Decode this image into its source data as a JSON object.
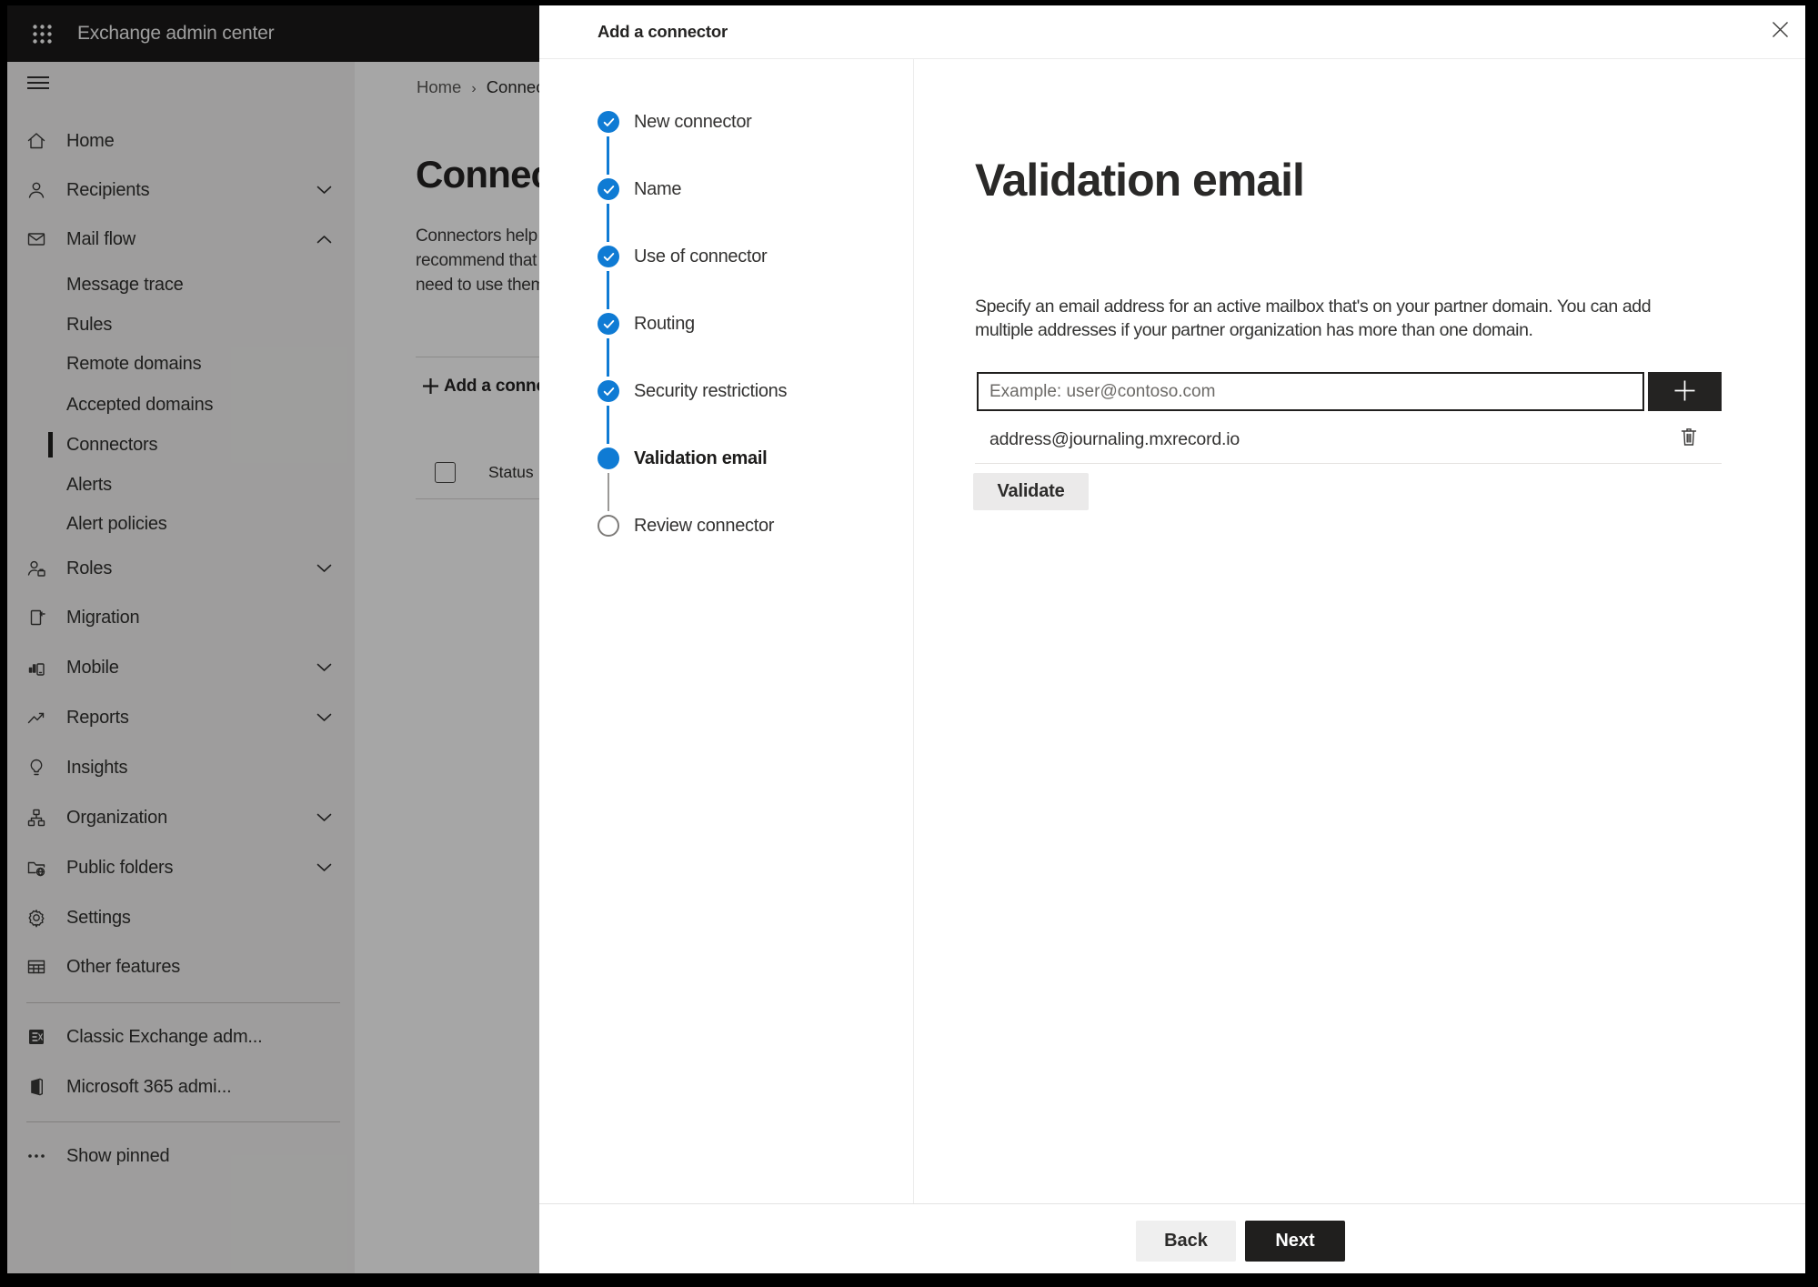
{
  "app": {
    "topbar_title": "Exchange admin center"
  },
  "sidebar": {
    "items": [
      {
        "label": "Home",
        "icon": "home-icon",
        "type": "top"
      },
      {
        "label": "Recipients",
        "icon": "people-icon",
        "type": "top",
        "chevron": "down"
      },
      {
        "label": "Mail flow",
        "icon": "mail-icon",
        "type": "top",
        "chevron": "up",
        "expanded": true
      },
      {
        "label": "Message trace",
        "type": "sub"
      },
      {
        "label": "Rules",
        "type": "sub"
      },
      {
        "label": "Remote domains",
        "type": "sub"
      },
      {
        "label": "Accepted domains",
        "type": "sub"
      },
      {
        "label": "Connectors",
        "type": "sub",
        "selected": true
      },
      {
        "label": "Alerts",
        "type": "sub"
      },
      {
        "label": "Alert policies",
        "type": "sub"
      },
      {
        "label": "Roles",
        "icon": "roles-icon",
        "type": "top",
        "chevron": "down"
      },
      {
        "label": "Migration",
        "icon": "migration-icon",
        "type": "top"
      },
      {
        "label": "Mobile",
        "icon": "mobile-icon",
        "type": "top",
        "chevron": "down"
      },
      {
        "label": "Reports",
        "icon": "reports-icon",
        "type": "top",
        "chevron": "down"
      },
      {
        "label": "Insights",
        "icon": "insights-icon",
        "type": "top"
      },
      {
        "label": "Organization",
        "icon": "organization-icon",
        "type": "top",
        "chevron": "down"
      },
      {
        "label": "Public folders",
        "icon": "public-folders-icon",
        "type": "top",
        "chevron": "down"
      },
      {
        "label": "Settings",
        "icon": "settings-icon",
        "type": "top"
      },
      {
        "label": "Other features",
        "icon": "other-features-icon",
        "type": "top"
      },
      {
        "label": "Classic Exchange adm...",
        "icon": "exchange-logo-icon",
        "type": "top",
        "divider_before": true
      },
      {
        "label": "Microsoft 365 admi...",
        "icon": "microsoft365-icon",
        "type": "top"
      },
      {
        "label": "Show pinned",
        "icon": "ellipsis-icon",
        "type": "top",
        "divider_before": true
      }
    ]
  },
  "background_page": {
    "breadcrumb": {
      "home": "Home",
      "separator": "›",
      "current": "Connectors"
    },
    "title": "Connectors",
    "description_lines": [
      "Connectors help",
      "recommend that",
      "need to use them"
    ],
    "add_connector_button": "Add a connector",
    "list_header": {
      "status": "Status"
    }
  },
  "modal": {
    "title": "Add a connector",
    "steps": [
      {
        "label": "New connector",
        "state": "completed"
      },
      {
        "label": "Name",
        "state": "completed"
      },
      {
        "label": "Use of connector",
        "state": "completed"
      },
      {
        "label": "Routing",
        "state": "completed"
      },
      {
        "label": "Security restrictions",
        "state": "completed"
      },
      {
        "label": "Validation email",
        "state": "current"
      },
      {
        "label": "Review connector",
        "state": "upcoming"
      }
    ],
    "content": {
      "heading": "Validation email",
      "description_lines": [
        "Specify an email address for an active mailbox that's on your partner domain. You can add",
        "multiple addresses if your partner organization has more than one domain."
      ],
      "email_input": {
        "value": "",
        "placeholder": "Example: user@contoso.com"
      },
      "addresses": [
        {
          "email": "address@journaling.mxrecord.io"
        }
      ],
      "validate_button": "Validate"
    },
    "footer": {
      "back_button": "Back",
      "next_button": "Next"
    }
  },
  "colors": {
    "accent_blue": "#0f7bd4",
    "topbar_bg": "#1b1a19",
    "next_button_bg": "#201f1e",
    "sidebar_bg": "#f3f2f1",
    "selected_indicator": "#201f1e"
  }
}
